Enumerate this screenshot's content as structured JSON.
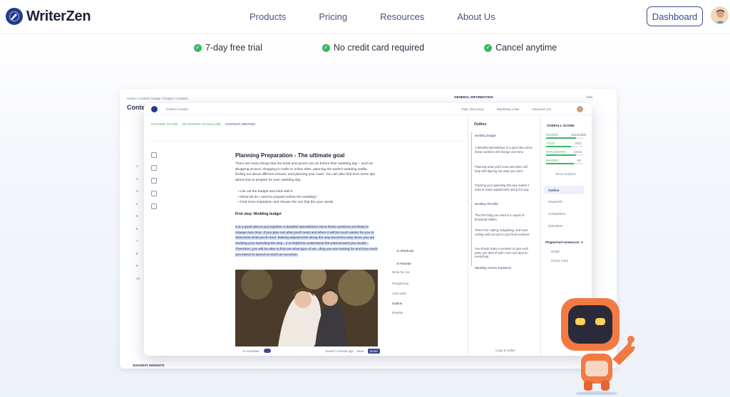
{
  "nav": {
    "brand": "WriterZen",
    "links": [
      "Products",
      "Pricing",
      "Resources",
      "About Us"
    ],
    "dashboard": "Dashboard"
  },
  "features": [
    "7-day free trial",
    "No credit card required",
    "Cancel anytime"
  ],
  "back_app": {
    "breadcrumb": "Home / Content Creator / Project / Content",
    "title": "Conte",
    "general_info": "GENERAL INFORMATION",
    "edit": "Edit",
    "suggest": "SUGGEST INSIGHTS",
    "row_numbers": [
      "1",
      "2",
      "3",
      "4",
      "5",
      "6",
      "7",
      "8",
      "9",
      "10"
    ]
  },
  "app": {
    "tab": "Content Creator",
    "chips": [
      "OUTLINE TO USE",
      "KEYWORDS TO INCLUDE",
      "CONTENT WRITING"
    ],
    "topbar": [
      "Topic Discovery",
      "Marketing Links",
      "Keyword List"
    ],
    "doc": {
      "title": "Planning Preparation - The ultimate goal",
      "intro": "There are many things that the bride and groom can do before their wedding day – such as shopping around, shopping in malls or online sites, planning the perfect wedding outfits, finding our about different venues, and planning your route. You can also find here some tips about how to prepare for your wedding day.",
      "bullets": [
        "List out the budget and stick with it",
        "What list do I need to prepare before the wedding?",
        "Find more inspiration and choose the one that fits your needs."
      ],
      "step": "First step: Wedding budget",
      "para": "It is a good idea to put together a detailed spreadsheet since these numbers are likely to change over time. If you plan out what you'll need and when it will be much easier for you to determine what you'll need. Making adjustments along the way becomes easy since you are tracking your spending the way... it is helpful to understand the total amount you would... Therefore, you will be able to find out what type of we...ding you are looking for and how much you intend to spend on such an occasion."
    },
    "ai": {
      "shortcuts": "AI Shortcuts",
      "rewrite": "AI Rewrite",
      "write_for_me": "Write for me",
      "items": [
        "Paraphrase",
        "Auto write",
        "Outline",
        "Rewrite"
      ]
    },
    "outline": {
      "title": "Outline",
      "items": [
        "wedding budget",
        "A detailed spreadsheet is a good idea since these numbers will change over time",
        "Planning what you'll need and when will help with figuring out what you need",
        "Tracking your spending this way makes it easy to make adjustments along the way",
        "wedding checklist",
        "The first thing you need is a couple of thousand dollars",
        "There'll be cutting, bargaining, and more cutting until you get to your final numbers",
        "You should make a promise to give each party one third of both room and deal on everything",
        "Wedding movies inspiration"
      ],
      "copy": "Copy to editor"
    },
    "score": {
      "overall": "OVERALL SCORE",
      "metrics": [
        {
          "label": "WORDS",
          "value": "1532/1890"
        },
        {
          "label": "TITLE",
          "value": "8/12"
        },
        {
          "label": "PARAGRAPH",
          "value": "12/15"
        },
        {
          "label": "IMAGES",
          "value": "3/4"
        }
      ],
      "show_analysis": "Show analysis",
      "tabs": [
        "Outline",
        "Keywords",
        "Competitors",
        "Questions"
      ],
      "plagiarised": "Plagiarised sentences: 3",
      "detail": "Detail",
      "check_more": "Check more"
    },
    "footer": {
      "assistant": "AI Assistant",
      "saved": "Saved 1 minute ago",
      "save": "Save",
      "done": "Done"
    }
  },
  "colors": {
    "brand": "#243b8a",
    "accent": "#3a4a8e",
    "check": "#3cb468",
    "robot": "#f27a45"
  }
}
